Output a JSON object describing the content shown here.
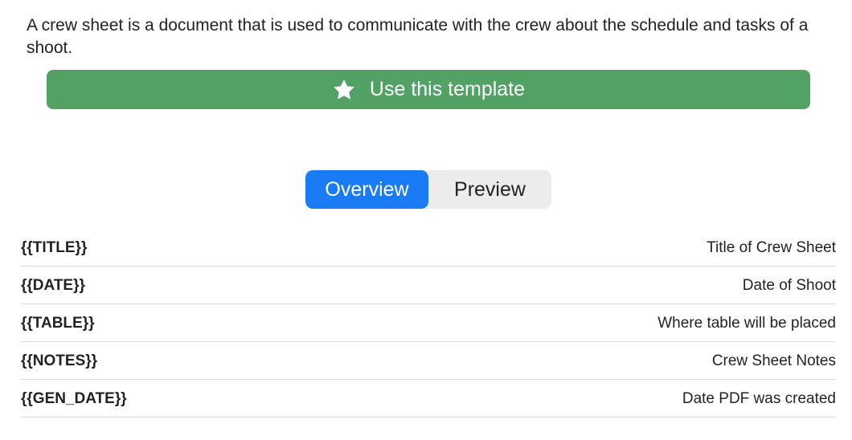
{
  "description": "A crew sheet is a document that is used to communicate with the crew about the schedule and tasks of a shoot.",
  "use_template_button": {
    "label": "Use this template",
    "icon": "star-icon",
    "color": "#53a265"
  },
  "tabs": [
    {
      "label": "Overview",
      "active": true
    },
    {
      "label": "Preview",
      "active": false
    }
  ],
  "accent_color": "#1a7cf5",
  "variables": [
    {
      "name": "{{TITLE}}",
      "description": "Title of Crew Sheet"
    },
    {
      "name": "{{DATE}}",
      "description": "Date of Shoot"
    },
    {
      "name": "{{TABLE}}",
      "description": "Where table will be placed"
    },
    {
      "name": "{{NOTES}}",
      "description": "Crew Sheet Notes"
    },
    {
      "name": "{{GEN_DATE}}",
      "description": "Date PDF was created"
    }
  ]
}
